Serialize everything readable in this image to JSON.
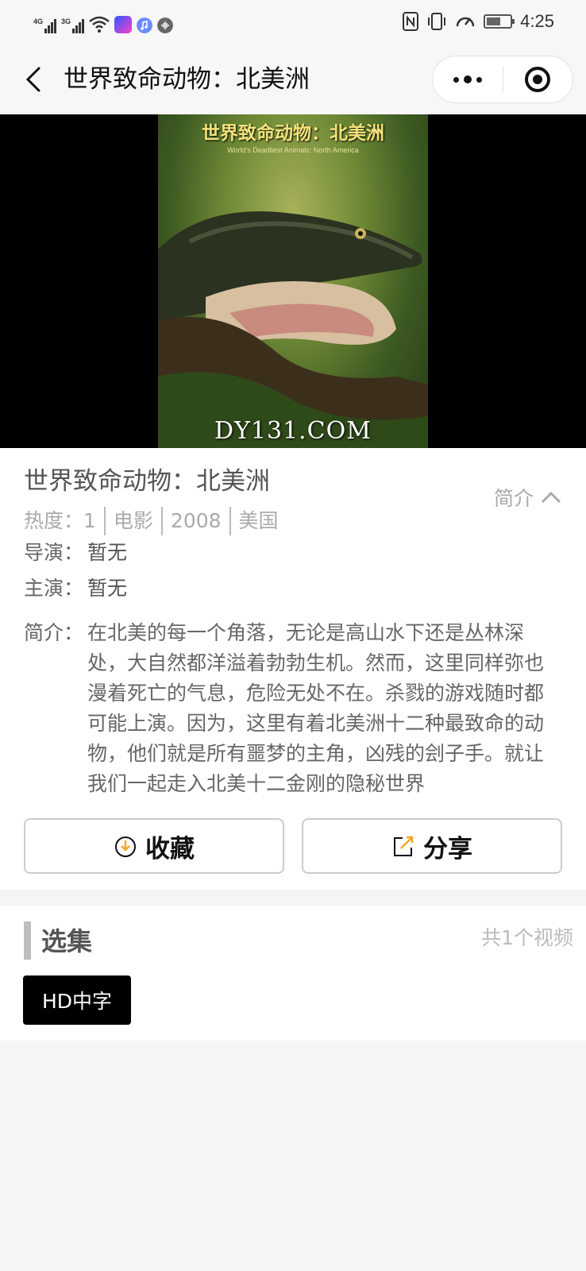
{
  "status_bar": {
    "signal_1_label": "4G",
    "signal_2_label": "3G",
    "time": "4:25",
    "battery_level": 0.6,
    "icons": [
      "signal-icon",
      "signal-icon",
      "wifi-icon",
      "app-notification-icon",
      "music-icon",
      "audio-icon",
      "nfc-icon",
      "vibrate-icon",
      "data-saver-icon",
      "battery-icon"
    ]
  },
  "nav": {
    "title": "世界致命动物：北美洲"
  },
  "player": {
    "poster_title": "世界致命动物：北美洲",
    "poster_subtitle": "World's Deadliest Animals: North America",
    "watermark": "DY131.COM"
  },
  "detail": {
    "title": "世界致命动物：北美洲",
    "meta": [
      "热度：1",
      "电影",
      "2008",
      "美国"
    ],
    "intro_toggle": "简介",
    "director_label": "导演：",
    "director": "暂无",
    "cast_label": "主演：",
    "cast": "暂无",
    "desc_label": "简介：",
    "description": "在北美的每一个角落，无论是高山水下还是丛林深处，大自然都洋溢着勃勃生机。然而，这里同样弥也漫着死亡的气息，危险无处不在。杀戮的游戏随时都可能上演。因为，这里有着北美洲十二种最致命的动物，他们就是所有噩梦的主角，凶残的刽子手。就让我们一起走入北美十二金刚的隐秘世界",
    "collect_label": "收藏",
    "share_label": "分享"
  },
  "episodes": {
    "title": "选集",
    "count": "共1个视频",
    "items": [
      "HD中字"
    ]
  },
  "colors": {
    "accent_orange": "#f5a623",
    "chip_bg": "#000000"
  }
}
